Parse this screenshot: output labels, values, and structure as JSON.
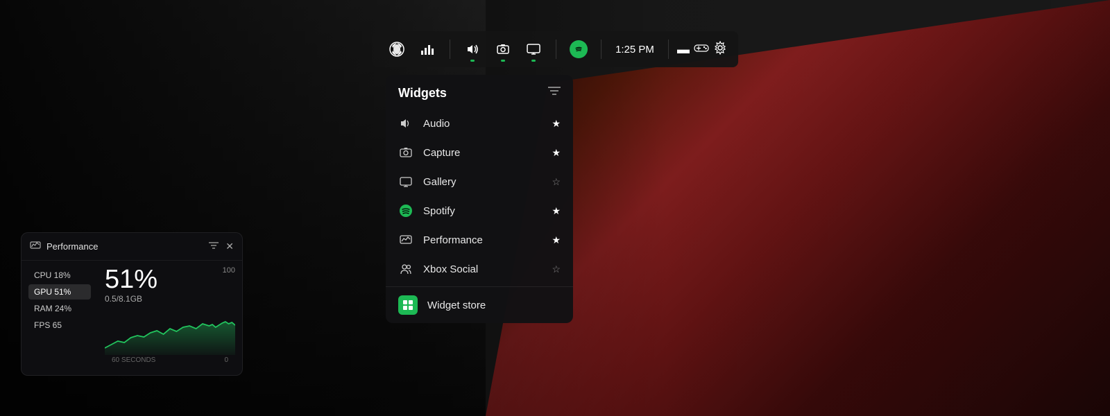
{
  "background": {
    "description": "Dark racing game scene with red sports car"
  },
  "topbar": {
    "time": "1:25 PM",
    "icons": [
      {
        "name": "xbox-logo",
        "label": "Xbox",
        "type": "xbox"
      },
      {
        "name": "performance-icon",
        "label": "Performance overlay"
      },
      {
        "name": "volume-icon",
        "label": "Volume",
        "active": true
      },
      {
        "name": "capture-icon",
        "label": "Capture",
        "active": true
      },
      {
        "name": "display-icon",
        "label": "Display",
        "active": true
      },
      {
        "name": "spotify-icon",
        "label": "Spotify",
        "type": "spotify"
      }
    ],
    "status": {
      "battery": "—",
      "controller": "🎮",
      "settings": "⚙"
    }
  },
  "widgets_panel": {
    "title": "Widgets",
    "filter_icon": "filter",
    "items": [
      {
        "id": "audio",
        "label": "Audio",
        "icon": "volume",
        "starred": true
      },
      {
        "id": "capture",
        "label": "Capture",
        "icon": "camera",
        "starred": true
      },
      {
        "id": "gallery",
        "label": "Gallery",
        "icon": "display",
        "starred": false
      },
      {
        "id": "spotify",
        "label": "Spotify",
        "icon": "spotify",
        "starred": true
      },
      {
        "id": "performance",
        "label": "Performance",
        "icon": "display-chart",
        "starred": true
      },
      {
        "id": "xbox-social",
        "label": "Xbox Social",
        "icon": "people",
        "starred": false
      }
    ],
    "store": {
      "label": "Widget store",
      "icon": "grid-plus"
    }
  },
  "performance_widget": {
    "title": "Performance",
    "stats": [
      {
        "label": "CPU 18%",
        "id": "cpu"
      },
      {
        "label": "GPU 51%",
        "id": "gpu",
        "active": true
      },
      {
        "label": "RAM 24%",
        "id": "ram"
      },
      {
        "label": "FPS 65",
        "id": "fps"
      }
    ],
    "main_value": "51%",
    "sub_value": "0.5/8.1GB",
    "max_label": "100",
    "chart_seconds_label": "60 SECONDS",
    "chart_zero_label": "0",
    "chart_color": "#22c55e"
  }
}
